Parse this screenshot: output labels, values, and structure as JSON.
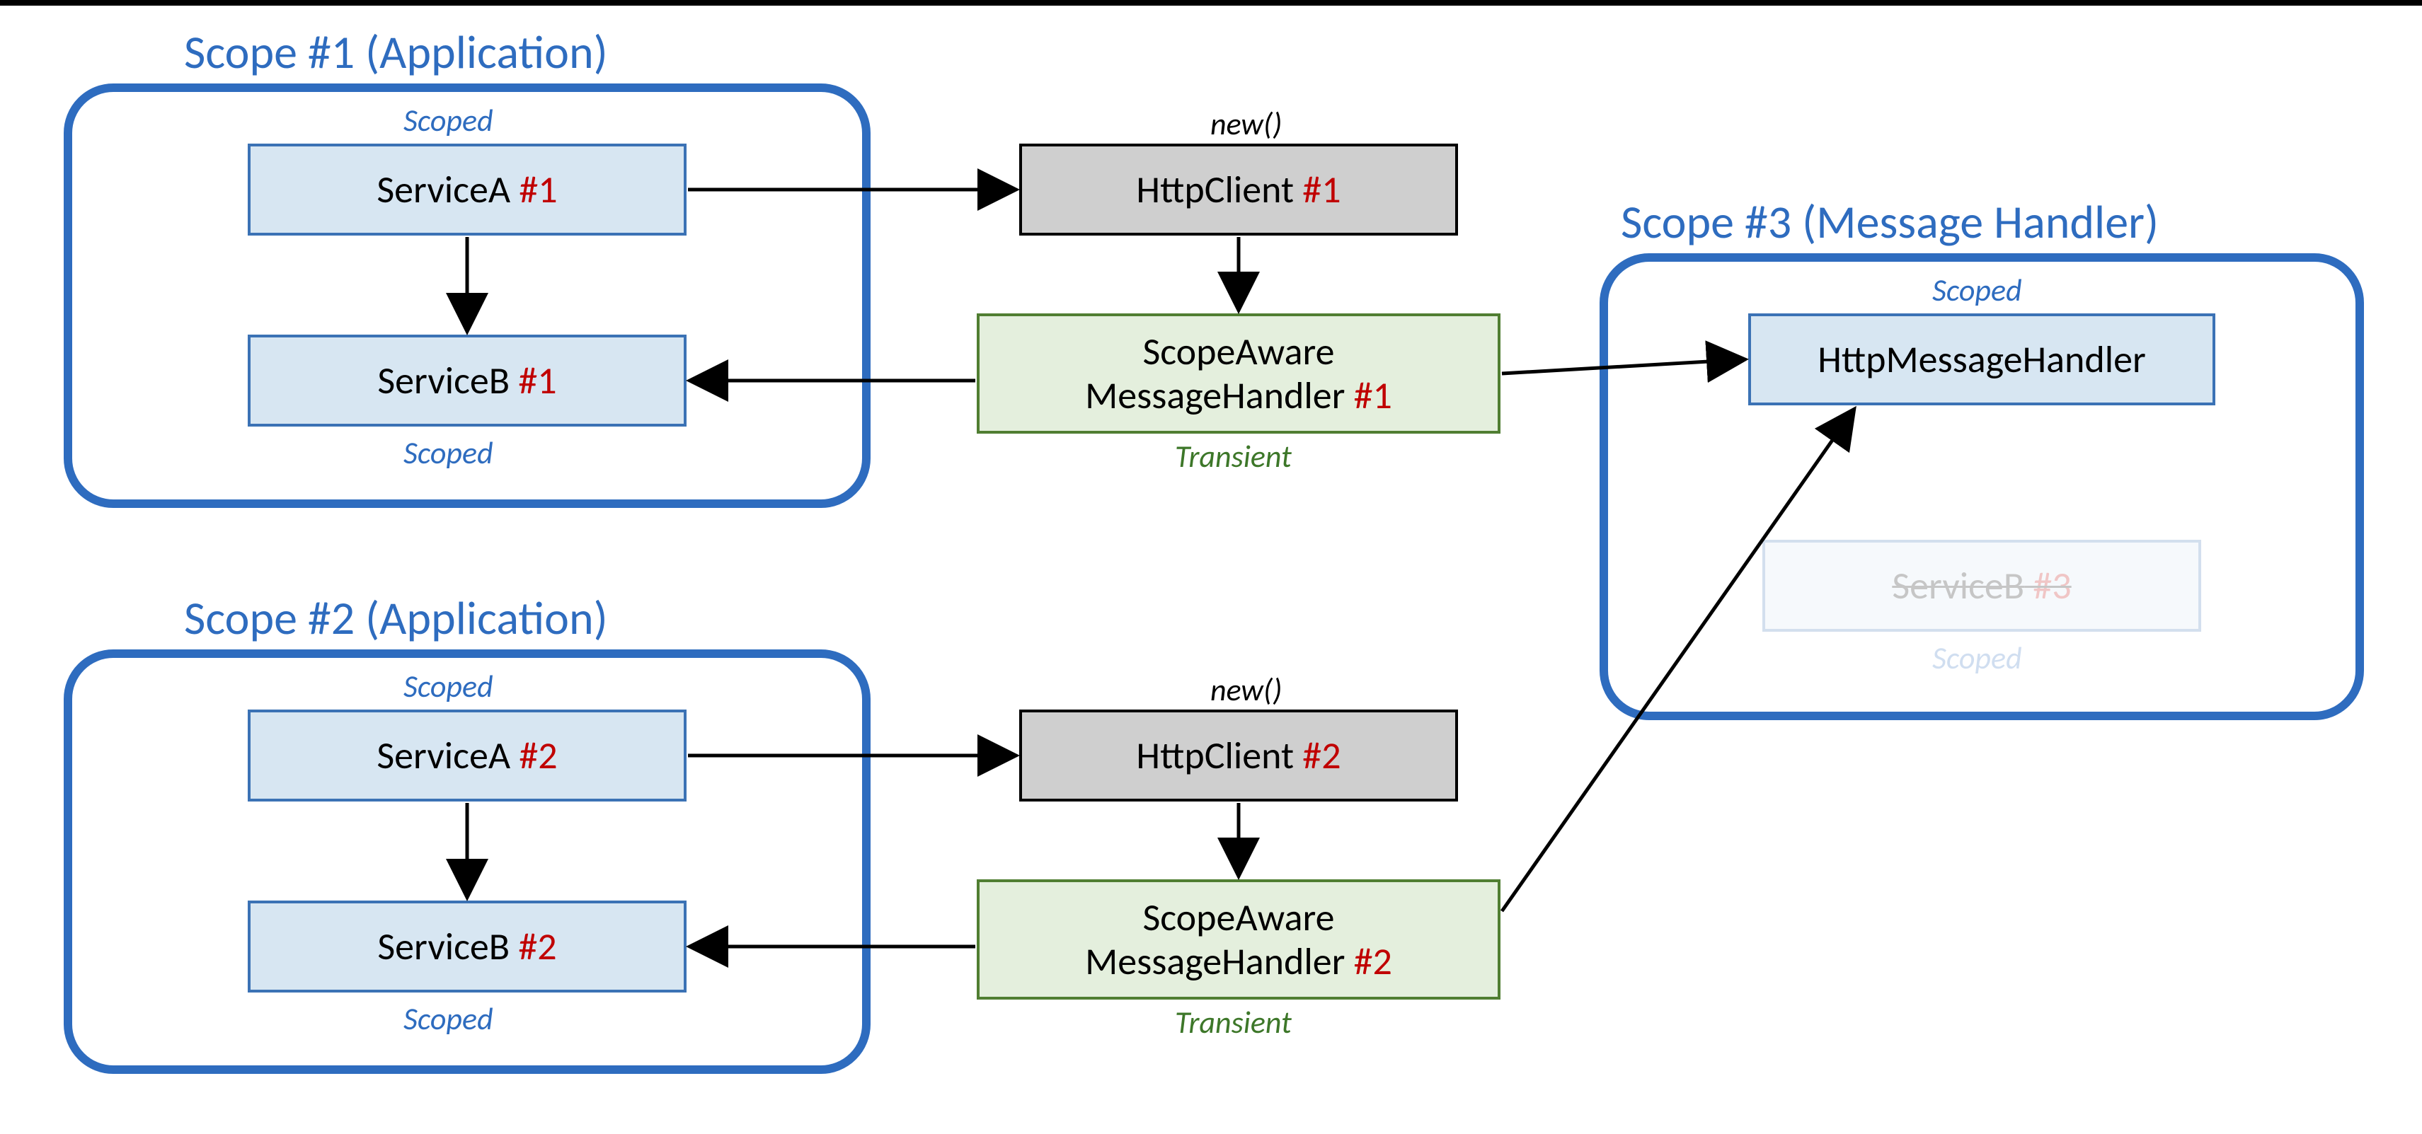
{
  "scope1": {
    "title": "Scope #1 (Application)",
    "serviceA": {
      "name": "ServiceA",
      "inst": " #1",
      "life": "Scoped"
    },
    "serviceB": {
      "name": "ServiceB",
      "inst": " #1",
      "life": "Scoped"
    }
  },
  "scope2": {
    "title": "Scope #2 (Application)",
    "serviceA": {
      "name": "ServiceA",
      "inst": " #2",
      "life": "Scoped"
    },
    "serviceB": {
      "name": "ServiceB",
      "inst": " #2",
      "life": "Scoped"
    }
  },
  "scope3": {
    "title": "Scope #3 (Message Handler)",
    "handler": {
      "name": "HttpMessageHandler",
      "life": "Scoped"
    },
    "serviceB": {
      "name": "ServiceB",
      "inst": " #3",
      "life": "Scoped"
    }
  },
  "httpClient1": {
    "name": "HttpClient",
    "inst": " #1",
    "life": "new()"
  },
  "httpClient2": {
    "name": "HttpClient",
    "inst": " #2",
    "life": "new()"
  },
  "scopeAware1": {
    "line1": "ScopeAware",
    "line2": "MessageHandler",
    "inst": " #1",
    "life": "Transient"
  },
  "scopeAware2": {
    "line1": "ScopeAware",
    "line2": "MessageHandler",
    "inst": " #2",
    "life": "Transient"
  },
  "colors": {
    "scopeBorder": "#2e6cbf",
    "blueFill": "#d7e6f2",
    "greyFill": "#cfcfcf",
    "greenFill": "#e4efdd",
    "red": "#c00000"
  }
}
